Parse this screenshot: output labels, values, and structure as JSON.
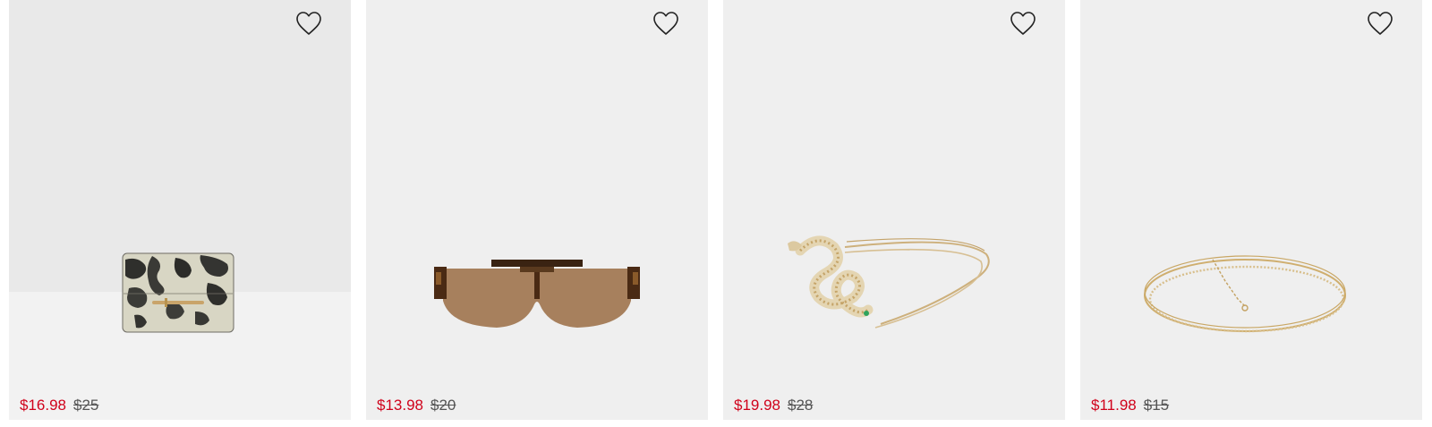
{
  "products": [
    {
      "name_icon": "snakeskin-wallet",
      "sale_price": "$16.98",
      "original_price": "$25"
    },
    {
      "name_icon": "shield-sunglasses",
      "sale_price": "$13.98",
      "original_price": "$20"
    },
    {
      "name_icon": "snake-headband",
      "sale_price": "$19.98",
      "original_price": "$28"
    },
    {
      "name_icon": "chain-choker-necklace",
      "sale_price": "$11.98",
      "original_price": "$15"
    }
  ],
  "colors": {
    "sale": "#d0021b",
    "card_bg": "#efefef"
  }
}
